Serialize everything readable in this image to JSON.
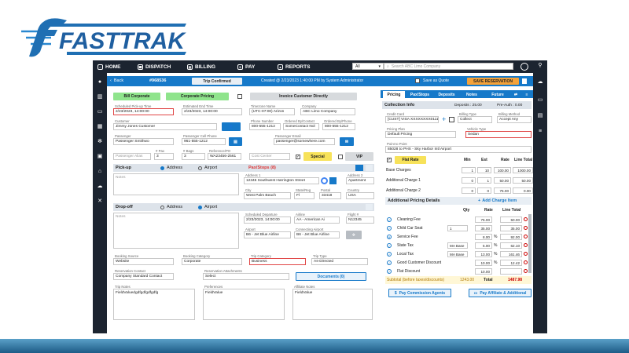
{
  "brand": {
    "name": "FASTTRAK"
  },
  "topnav": {
    "items": [
      {
        "label": "HOME",
        "icon": "home-icon"
      },
      {
        "label": "DISPATCH",
        "icon": "dispatch-icon"
      },
      {
        "label": "BILLING",
        "icon": "billing-icon"
      },
      {
        "label": "PAY",
        "icon": "pay-icon"
      },
      {
        "label": "REPORTS",
        "icon": "reports-icon"
      }
    ],
    "scope": "All",
    "search_placeholder": "Search ABC Limo Company"
  },
  "header": {
    "back": "Back",
    "res_no": "#968536",
    "status": "Trip Confirmed",
    "created": "Created @ 2/23/2023 1:40:00 PM by System Administrator",
    "save_quote": "Save as Quote",
    "save_btn": "SAVE RESERVATION"
  },
  "billing": {
    "bill_corporate": "Bill Corporate",
    "corporate_pricing": "Corporate Pricing",
    "invoice_direct": "Invoice Customer Directly"
  },
  "fields": {
    "sched_pickup_lbl": "Scheduled Pick-up Time",
    "sched_pickup": "2/23/2023, 14:00:00",
    "est_end_lbl": "Estimated End Time",
    "est_end": "2/23/2023, 14:00:00",
    "tz_lbl": "Timezone Name",
    "tz": "(UTC-07:00) Arizon",
    "company_lbl": "Company",
    "company": "ABC Limo Company",
    "customer_lbl": "Customer",
    "customer": "Jimmy Jones Customer",
    "phone_lbl": "Phone Number",
    "phone": "800-555-1212",
    "ordered_contact_lbl": "Ordered By/Contact",
    "ordered_contact": "SomeContact Nol",
    "ordered_phone_lbl": "Ordered By/Phone",
    "ordered_phone": "800-555-1212",
    "passenger_lbl": "Passenger",
    "passenger": "Passenger Smithwo",
    "cell_lbl": "Passenger Cell Phone",
    "cell": "961-555-1212",
    "email_lbl": "Passenger Email",
    "email": "passenger@somewhere.com",
    "alias_ph": "Passenger Alias",
    "pax_lbl": "# Pax",
    "pax": "3",
    "bags_lbl": "# Bags",
    "bags": "3",
    "ref_lbl": "Reference/PO",
    "ref": "WA23456-2561",
    "cost_center_ph": "Cost Center",
    "special": "Special",
    "vip": "VIP"
  },
  "pickup": {
    "title": "Pick-up",
    "address": "Address",
    "airport": "Airport",
    "paxstops": "Pax/Stops (8)",
    "addr1_lbl": "Address 1",
    "addr1": "12345 Southwest Harrington Street",
    "addr2_lbl": "Address 2",
    "addr2": "Apartment",
    "city_lbl": "City",
    "city": "West Palm Beach",
    "state_lbl": "State/Reg",
    "state": "Fl",
    "postal_lbl": "Postal",
    "postal": "33418",
    "country_lbl": "Country",
    "country": "USA",
    "notes_ph": "Notes"
  },
  "dropoff": {
    "title": "Drop-off",
    "address": "Address",
    "airport": "Airport",
    "notes_ph": "Notes",
    "sched_dep_lbl": "Scheduled Departure",
    "sched_dep": "2/23/2023, 14:00:00",
    "airline_lbl": "Airline",
    "airline": "AA - American Ai",
    "flight_lbl": "Flight #",
    "flight": "N12345",
    "airport_lbl": "Airport",
    "airport_val": "B6 - Jet Blue Airline",
    "conn_lbl": "Connecting Airport",
    "conn": "B6 - Jet Blue Airline"
  },
  "booking": {
    "source_lbl": "Booking Source",
    "source": "Website",
    "category_lbl": "Booking Category",
    "category": "Corporate",
    "trip_cat_lbl": "Trip Category",
    "trip_cat": "Business",
    "trip_type_lbl": "Trip Type",
    "trip_type": "As-Directed",
    "contact_lbl": "Reservation Contact",
    "contact": "Company Standard Contact",
    "attach_lbl": "Reservation Attachments",
    "attach": "Select",
    "documents": "Documents (0)"
  },
  "notes": {
    "trip_lbl": "Trip Notes",
    "trip": "FieldValuedgdfgdfgdfgdfg",
    "pref_lbl": "Preferences",
    "pref": "FieldValue",
    "aff_lbl": "Affiliate Notes",
    "aff": "FieldValue"
  },
  "tabs": [
    "Pricing",
    "Pax/Stops",
    "Deposits",
    "Notes",
    "Future"
  ],
  "collection": {
    "title": "Collection Info",
    "deposits": "Deposits : 25.00",
    "preauth": "Pre-Auth : 0.00",
    "card_lbl": "Credit Card",
    "card": "[CUST] VISA XXXXXXXX0111",
    "billing_type_lbl": "Billing Type",
    "billing_type": "Collect",
    "billing_method_lbl": "Billing Method",
    "billing_method": "Accept Any",
    "plan_lbl": "Pricing Plan",
    "plan": "Default Pricing",
    "vehicle_lbl": "Vehicle Type",
    "vehicle": "Sedan",
    "p2p_lbl": "Point to Point",
    "p2p": "85028 to PHX - Sky Harbor Intl Airport"
  },
  "rates": {
    "flat_rate": "Flat Rate",
    "headers": [
      "Min",
      "Est",
      "Rate",
      "Line Total"
    ],
    "rows": [
      {
        "label": "Base Charges",
        "min": "1",
        "est": "10",
        "rate": "100.00",
        "total": "1000.00"
      },
      {
        "label": "Additional Charge 1",
        "min": "0",
        "est": "1",
        "rate": "50.00",
        "total": "50.00"
      },
      {
        "label": "Additional Charge 2",
        "min": "0",
        "est": "0",
        "rate": "75.00",
        "total": "0.00"
      }
    ],
    "add_charge": "Add Charge Item"
  },
  "addl": {
    "title": "Additional Pricing Details",
    "headers": [
      "Qty",
      "Rate",
      "Line Total"
    ],
    "rows": [
      {
        "label": "Cleaning Fee",
        "qty": "",
        "rate": "75.00",
        "total": "50.00",
        "icon": "check-icon"
      },
      {
        "label": "Child Car Seat",
        "qty": "1",
        "rate": "35.00",
        "total": "35.00",
        "icon": "check-icon"
      },
      {
        "label": "Service Fee",
        "qty": "",
        "rate": "8.00",
        "pct": "%",
        "total": "92.00",
        "icon": "close-icon"
      },
      {
        "label": "State Tax",
        "qty": "MA Base",
        "rate": "5.00",
        "pct": "%",
        "total": "62.10",
        "icon": "check-icon"
      },
      {
        "label": "Local Tax",
        "qty": "MA Base",
        "rate": "13.00",
        "pct": "%",
        "total": "161.46",
        "icon": "check-icon"
      },
      {
        "label": "Good Customer Discount",
        "qty": "",
        "rate": "10.00",
        "pct": "%",
        "total": "12.42",
        "icon": "check-icon"
      },
      {
        "label": "Flat Discount",
        "qty": "",
        "rate": "10.00",
        "total": "",
        "icon": "check-icon"
      }
    ],
    "subtotal_lbl": "Subtotal (before taxes/discounts)",
    "subtotal": "1243.00",
    "total_lbl": "Total",
    "total": "1487.98"
  },
  "footer": {
    "commission": "Pay Commission Agents",
    "affiliate": "Pay Affiliate & Additional"
  },
  "colors": {
    "accent": "#1679c9",
    "nav": "#1c2430",
    "green": "#8fe48c",
    "yellow": "#f7e25a",
    "orange": "#f4a23a"
  }
}
